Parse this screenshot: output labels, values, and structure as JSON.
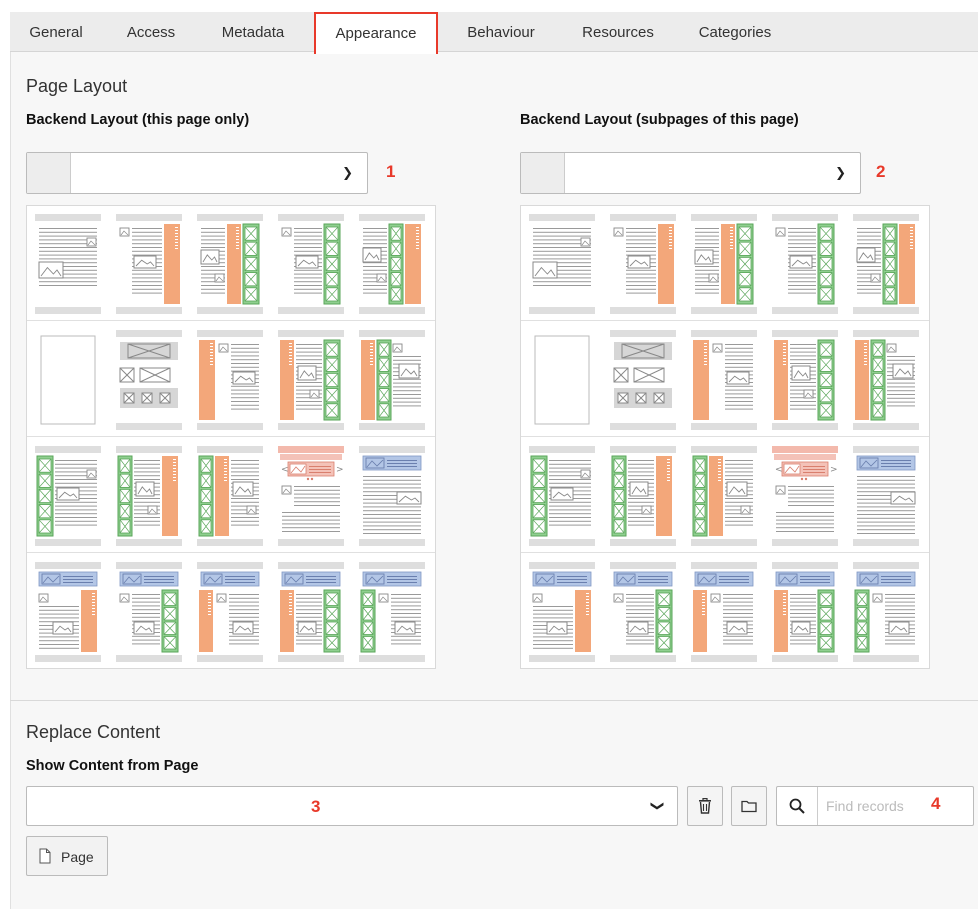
{
  "tabs": [
    {
      "label": "General"
    },
    {
      "label": "Access"
    },
    {
      "label": "Metadata"
    },
    {
      "label": "Appearance",
      "active": true
    },
    {
      "label": "Behaviour"
    },
    {
      "label": "Resources"
    },
    {
      "label": "Categories"
    }
  ],
  "page_layout": {
    "title": "Page Layout",
    "this_page": {
      "label": "Backend Layout (this page only)",
      "value": "",
      "marker": "1"
    },
    "subpages": {
      "label": "Backend Layout (subpages of this page)",
      "value": "",
      "marker": "2"
    }
  },
  "replace_content": {
    "title": "Replace Content",
    "field_label": "Show Content from Page",
    "value": "",
    "marker_select": "3",
    "find_placeholder": "Find records",
    "marker_find": "4",
    "page_button_label": "Page"
  },
  "layout_thumbnails": [
    [
      "full-width-text-image",
      "text-with-right-sidebar",
      "text-with-right-sidebar-and-boxes",
      "text-with-right-box-column",
      "text-with-double-right-column"
    ],
    [
      "empty-layout",
      "image-gallery-grid",
      "left-sidebar-with-text",
      "left-sidebar-text-right-boxes",
      "left-sidebar-boxes-text"
    ],
    [
      "left-boxes-with-text",
      "left-boxes-text-right-sidebar",
      "left-boxes-sidebar-text",
      "carousel-slider-layout",
      "banner-with-text"
    ],
    [
      "banner-text-right-sidebar",
      "banner-text-right-boxes",
      "banner-left-sidebar-text",
      "banner-sidebar-text-boxes",
      "banner-left-boxes-text"
    ]
  ],
  "colors": {
    "accent_red": "#e8392a",
    "orange": "#f3a77a",
    "green": "#8fcf8f",
    "blue": "#b3c6e6",
    "pink": "#f4c2b8"
  }
}
